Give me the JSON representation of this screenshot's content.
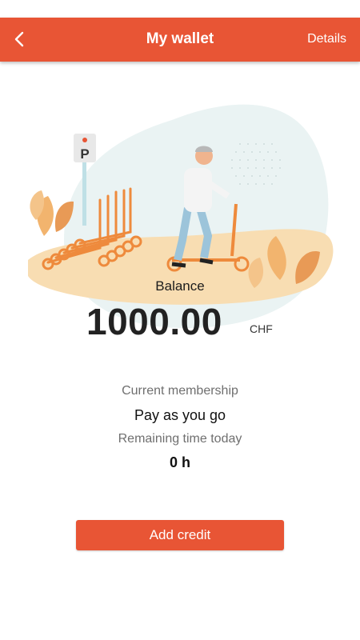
{
  "header": {
    "back_icon": "chevron-left-icon",
    "title": "My wallet",
    "details_label": "Details"
  },
  "balance": {
    "label": "Balance",
    "amount": "1000.00",
    "currency": "CHF"
  },
  "membership": {
    "label": "Current membership",
    "plan": "Pay as you go",
    "remaining_label": "Remaining time today",
    "remaining_value": "0 h"
  },
  "actions": {
    "add_credit_label": "Add credit"
  },
  "illustration": {
    "parking_sign_letter": "P"
  },
  "colors": {
    "accent": "#E85535",
    "ground": "#F8DDB2",
    "scooter": "#EE8A3C",
    "sky": "#EAF3F3"
  }
}
